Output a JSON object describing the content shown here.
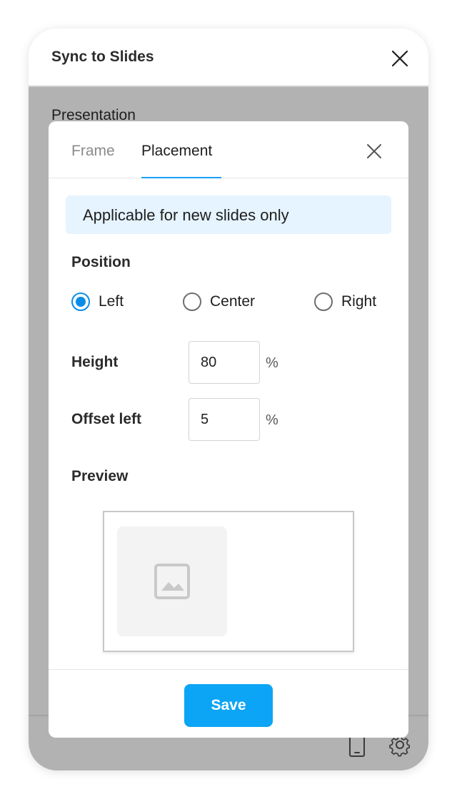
{
  "panel": {
    "title": "Sync to Slides",
    "presentation_label": "Presentation"
  },
  "modal": {
    "tabs": [
      {
        "label": "Frame",
        "active": false
      },
      {
        "label": "Placement",
        "active": true
      }
    ],
    "notice": "Applicable for new slides only",
    "position": {
      "label": "Position",
      "options": [
        {
          "label": "Left",
          "checked": true
        },
        {
          "label": "Center",
          "checked": false
        },
        {
          "label": "Right",
          "checked": false
        }
      ]
    },
    "height": {
      "label": "Height",
      "value": "80",
      "unit": "%"
    },
    "offset_left": {
      "label": "Offset left",
      "value": "5",
      "unit": "%"
    },
    "preview": {
      "label": "Preview",
      "icon": "image-icon"
    },
    "save_label": "Save"
  },
  "icons": [
    "close-icon",
    "device-icon",
    "settings-icon",
    "image-icon"
  ],
  "colors": {
    "accent": "#0c8ce9",
    "save_button": "#0ca5f5",
    "tab_underline": "#18a0fb",
    "notice_bg": "#e5f4ff",
    "overlay": "#b2b2b2"
  }
}
